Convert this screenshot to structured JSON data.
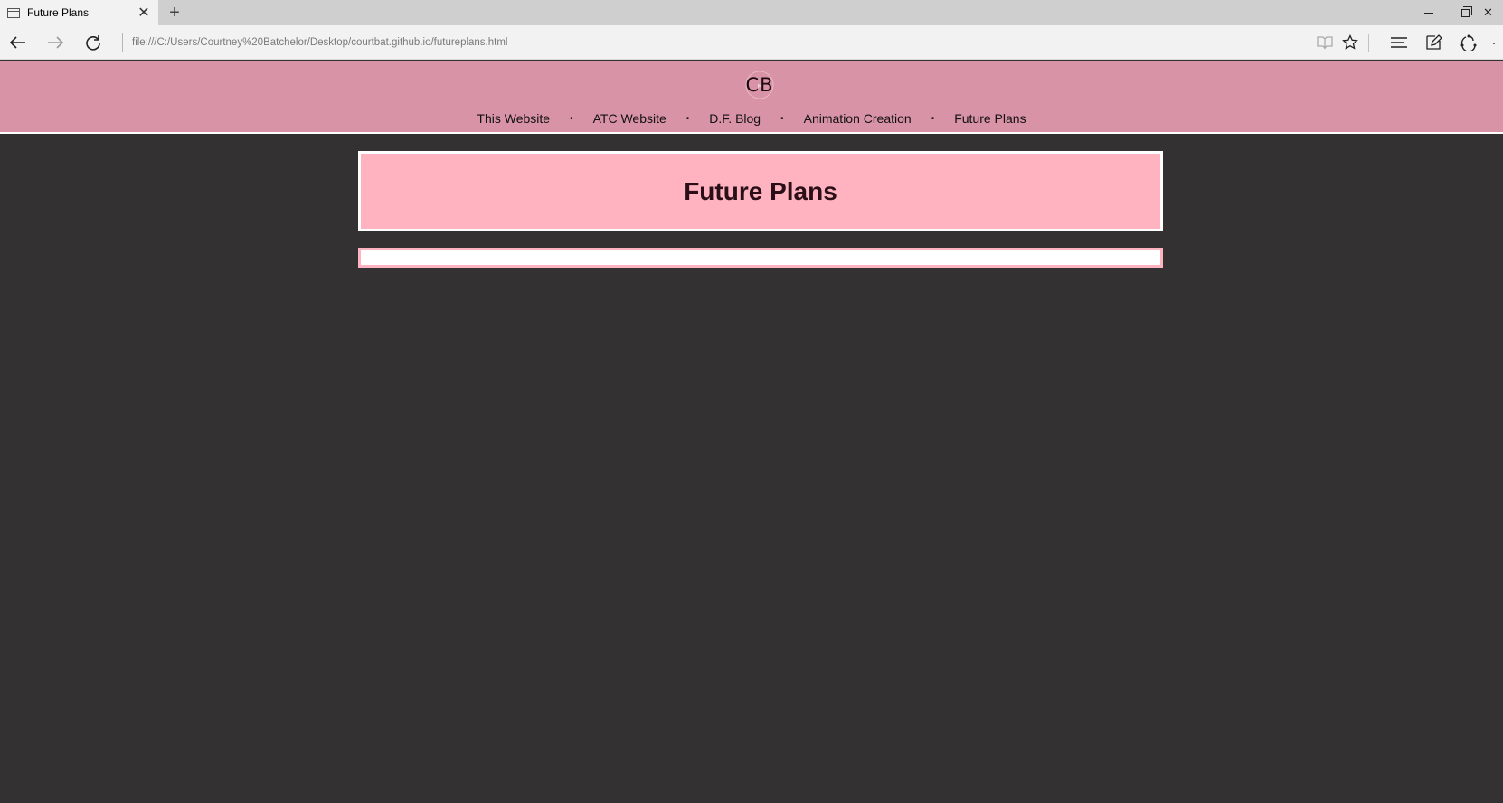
{
  "browser": {
    "tab": {
      "title": "Future Plans"
    },
    "address": {
      "url": "file:///C:/Users/Courtney%20Batchelor/Desktop/courtbat.github.io/futureplans.html"
    }
  },
  "site": {
    "logo_letters": "CB",
    "nav": [
      {
        "label": "This Website"
      },
      {
        "label": "ATC Website"
      },
      {
        "label": "D.F. Blog"
      },
      {
        "label": "Animation Creation"
      },
      {
        "label": "Future Plans"
      }
    ],
    "nav_separator": "•",
    "active_nav_index": 4,
    "page_title": "Future Plans"
  },
  "colors": {
    "header_bg": "#d993a6",
    "title_box_bg": "#ffb3c0",
    "page_bg": "#333132"
  }
}
